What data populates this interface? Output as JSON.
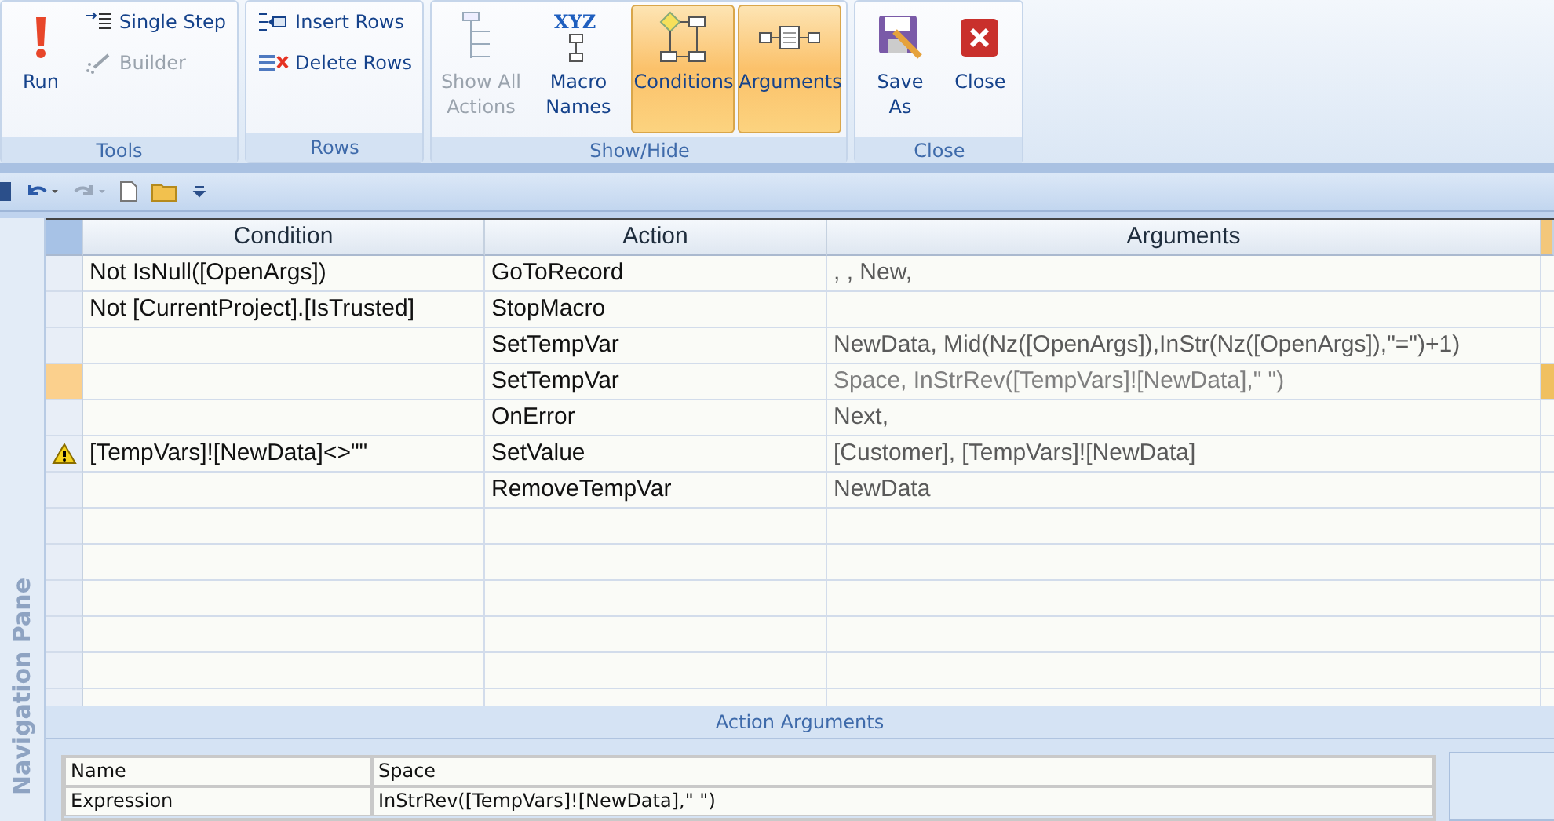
{
  "ribbon": {
    "groups": [
      {
        "label": "Tools",
        "buttons": [
          {
            "label": "Run",
            "kind": "large",
            "disabled": false,
            "selected": false
          },
          {
            "label": "Single Step",
            "kind": "small",
            "disabled": false,
            "selected": false
          },
          {
            "label": "Builder",
            "kind": "small",
            "disabled": true,
            "selected": false
          }
        ]
      },
      {
        "label": "Rows",
        "buttons": [
          {
            "label": "Insert Rows",
            "kind": "small",
            "disabled": false,
            "selected": false
          },
          {
            "label": "Delete Rows",
            "kind": "small",
            "disabled": false,
            "selected": false
          }
        ]
      },
      {
        "label": "Show/Hide",
        "buttons": [
          {
            "label": "Show All Actions",
            "kind": "large",
            "disabled": true,
            "selected": false
          },
          {
            "label": "Macro Names",
            "icon_text": "XYZ",
            "kind": "large",
            "disabled": false,
            "selected": false
          },
          {
            "label": "Conditions",
            "kind": "large",
            "disabled": false,
            "selected": true
          },
          {
            "label": "Arguments",
            "kind": "large",
            "disabled": false,
            "selected": true
          }
        ]
      },
      {
        "label": "Close",
        "buttons": [
          {
            "label": "Save As",
            "kind": "large",
            "disabled": false,
            "selected": false
          },
          {
            "label": "Close",
            "kind": "large",
            "disabled": false,
            "selected": false
          }
        ]
      }
    ]
  },
  "navigation_pane": {
    "title": "Navigation Pane"
  },
  "grid": {
    "columns": [
      "Condition",
      "Action",
      "Arguments"
    ],
    "rows": [
      {
        "condition": "Not IsNull([OpenArgs])",
        "action": "GoToRecord",
        "arguments": ", , New,",
        "selected": false,
        "warning": false
      },
      {
        "condition": "Not [CurrentProject].[IsTrusted]",
        "action": "StopMacro",
        "arguments": "",
        "selected": false,
        "warning": false
      },
      {
        "condition": "",
        "action": "SetTempVar",
        "arguments": "NewData, Mid(Nz([OpenArgs]),InStr(Nz([OpenArgs]),\"=\")+1)",
        "selected": false,
        "warning": false
      },
      {
        "condition": "",
        "action": "SetTempVar",
        "arguments": "Space, InStrRev([TempVars]![NewData],\" \")",
        "selected": true,
        "warning": false
      },
      {
        "condition": "",
        "action": "OnError",
        "arguments": "Next,",
        "selected": false,
        "warning": false
      },
      {
        "condition": "[TempVars]![NewData]<>\"\"",
        "action": "SetValue",
        "arguments": "[Customer], [TempVars]![NewData]",
        "selected": false,
        "warning": true
      },
      {
        "condition": "",
        "action": "RemoveTempVar",
        "arguments": "NewData",
        "selected": false,
        "warning": false
      }
    ]
  },
  "action_arguments": {
    "title": "Action Arguments",
    "fields": [
      {
        "label": "Name",
        "value": "Space"
      },
      {
        "label": "Expression",
        "value": "InStrRev([TempVars]![NewData],\" \")"
      }
    ]
  }
}
